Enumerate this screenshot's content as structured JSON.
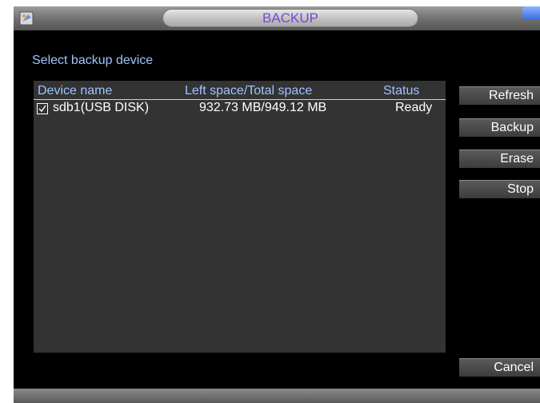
{
  "window": {
    "title": "BACKUP"
  },
  "section_label": "Select backup device",
  "table": {
    "columns": [
      "Device name",
      "Left space/Total space",
      "Status"
    ],
    "rows": [
      {
        "checked": true,
        "device": "sdb1(USB DISK)",
        "space": "932.73 MB/949.12 MB",
        "status": "Ready"
      }
    ]
  },
  "buttons": {
    "refresh": "Refresh",
    "backup": "Backup",
    "erase": "Erase",
    "stop": "Stop",
    "cancel": "Cancel"
  },
  "colors": {
    "title_text": "#7a45d6",
    "label_text": "#9ec3ff",
    "panel_bg": "#333333",
    "window_bg": "#000000"
  },
  "icons": {
    "app": "app-logo-icon",
    "corner": "window-corner-icon",
    "check": "checkmark-icon"
  }
}
